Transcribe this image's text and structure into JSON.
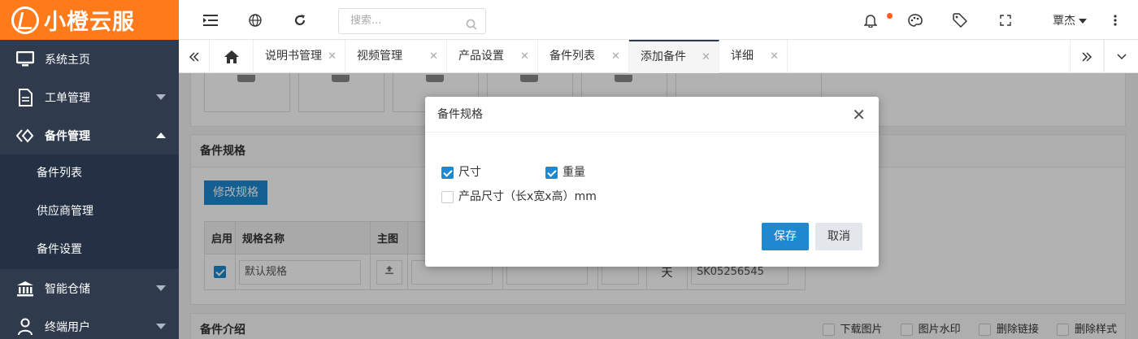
{
  "app": {
    "brand": "小橙云服"
  },
  "sidebar": {
    "items": [
      {
        "label": "系统主页",
        "icon": "monitor-icon"
      },
      {
        "label": "工单管理",
        "icon": "document-icon"
      },
      {
        "label": "备件管理",
        "icon": "diamond-icon",
        "expanded": true
      },
      {
        "label": "智能仓储",
        "icon": "bank-icon"
      },
      {
        "label": "终端用户",
        "icon": "user-icon"
      }
    ],
    "submenu": [
      "备件列表",
      "供应商管理",
      "备件设置"
    ]
  },
  "header": {
    "search_placeholder": "搜索...",
    "user_name": "覃杰"
  },
  "tabs": [
    {
      "label": "说明书管理"
    },
    {
      "label": "视频管理"
    },
    {
      "label": "产品设置"
    },
    {
      "label": "备件列表"
    },
    {
      "label": "添加备件",
      "active": true
    },
    {
      "label": "详细"
    }
  ],
  "page": {
    "spec_section_title": "备件规格",
    "modify_spec_button": "修改规格",
    "table": {
      "headers": [
        "启用",
        "规格名称",
        "主图"
      ],
      "row": {
        "enabled": true,
        "spec_name": "默认规格",
        "unit": "天",
        "sku": "SK05256545"
      }
    },
    "intro_section_title": "备件介绍",
    "intro_options": [
      "下载图片",
      "图片水印",
      "删除链接",
      "删除样式"
    ]
  },
  "modal": {
    "title": "备件规格",
    "options": [
      {
        "label": "尺寸",
        "checked": true
      },
      {
        "label": "重量",
        "checked": true
      },
      {
        "label": "产品尺寸（长x宽x高）mm",
        "checked": false
      }
    ],
    "save_label": "保存",
    "cancel_label": "取消"
  }
}
